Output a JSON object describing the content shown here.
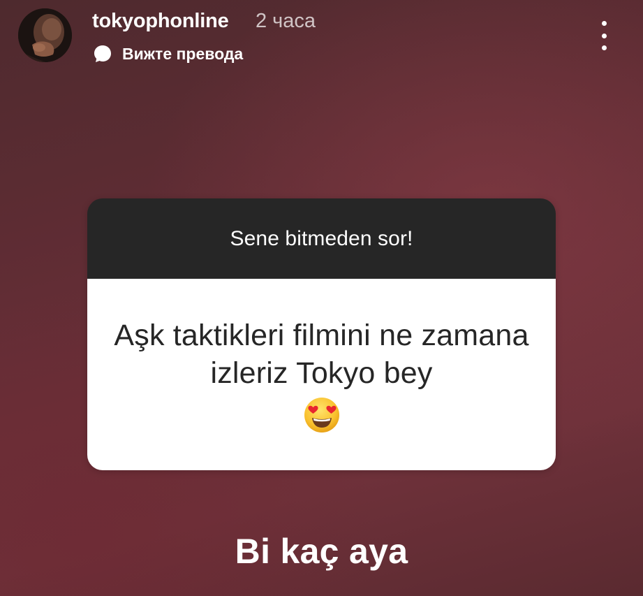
{
  "header": {
    "username": "tokyophonline",
    "time_ago": "2 часа",
    "translate_label": "Вижте превода",
    "translate_icon": "speech-bubble-icon",
    "more_icon": "more-vertical-icon"
  },
  "question_card": {
    "prompt": "Sene bitmeden sor!",
    "question": "Aşk taktikleri filmini ne zamana izleriz Tokyo bey",
    "emoji": "heart-eyes-emoji"
  },
  "answer": {
    "text": "Bi kaç aya"
  },
  "colors": {
    "background": "#5d2c33",
    "card_header": "#262626",
    "card_body": "#ffffff",
    "question_text": "#262626"
  }
}
